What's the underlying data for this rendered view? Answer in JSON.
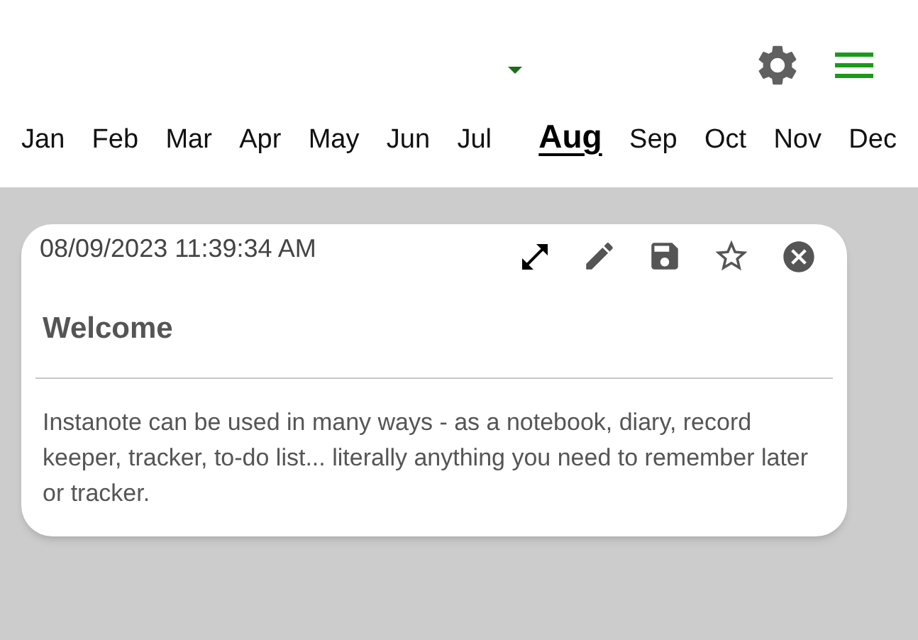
{
  "months": [
    {
      "label": "Jan",
      "selected": false
    },
    {
      "label": "Feb",
      "selected": false
    },
    {
      "label": "Mar",
      "selected": false
    },
    {
      "label": "Apr",
      "selected": false
    },
    {
      "label": "May",
      "selected": false
    },
    {
      "label": "Jun",
      "selected": false
    },
    {
      "label": "Jul",
      "selected": false
    },
    {
      "label": "Aug",
      "selected": true
    },
    {
      "label": "Sep",
      "selected": false
    },
    {
      "label": "Oct",
      "selected": false
    },
    {
      "label": "Nov",
      "selected": false
    },
    {
      "label": "Dec",
      "selected": false
    }
  ],
  "note": {
    "timestamp": "08/09/2023 11:39:34 AM",
    "title": "Welcome",
    "body": "Instanote can be used in many ways - as a notebook, diary, record keeper, tracker, to-do list... literally anything you need to remember later or tracker.",
    "starred": false
  }
}
